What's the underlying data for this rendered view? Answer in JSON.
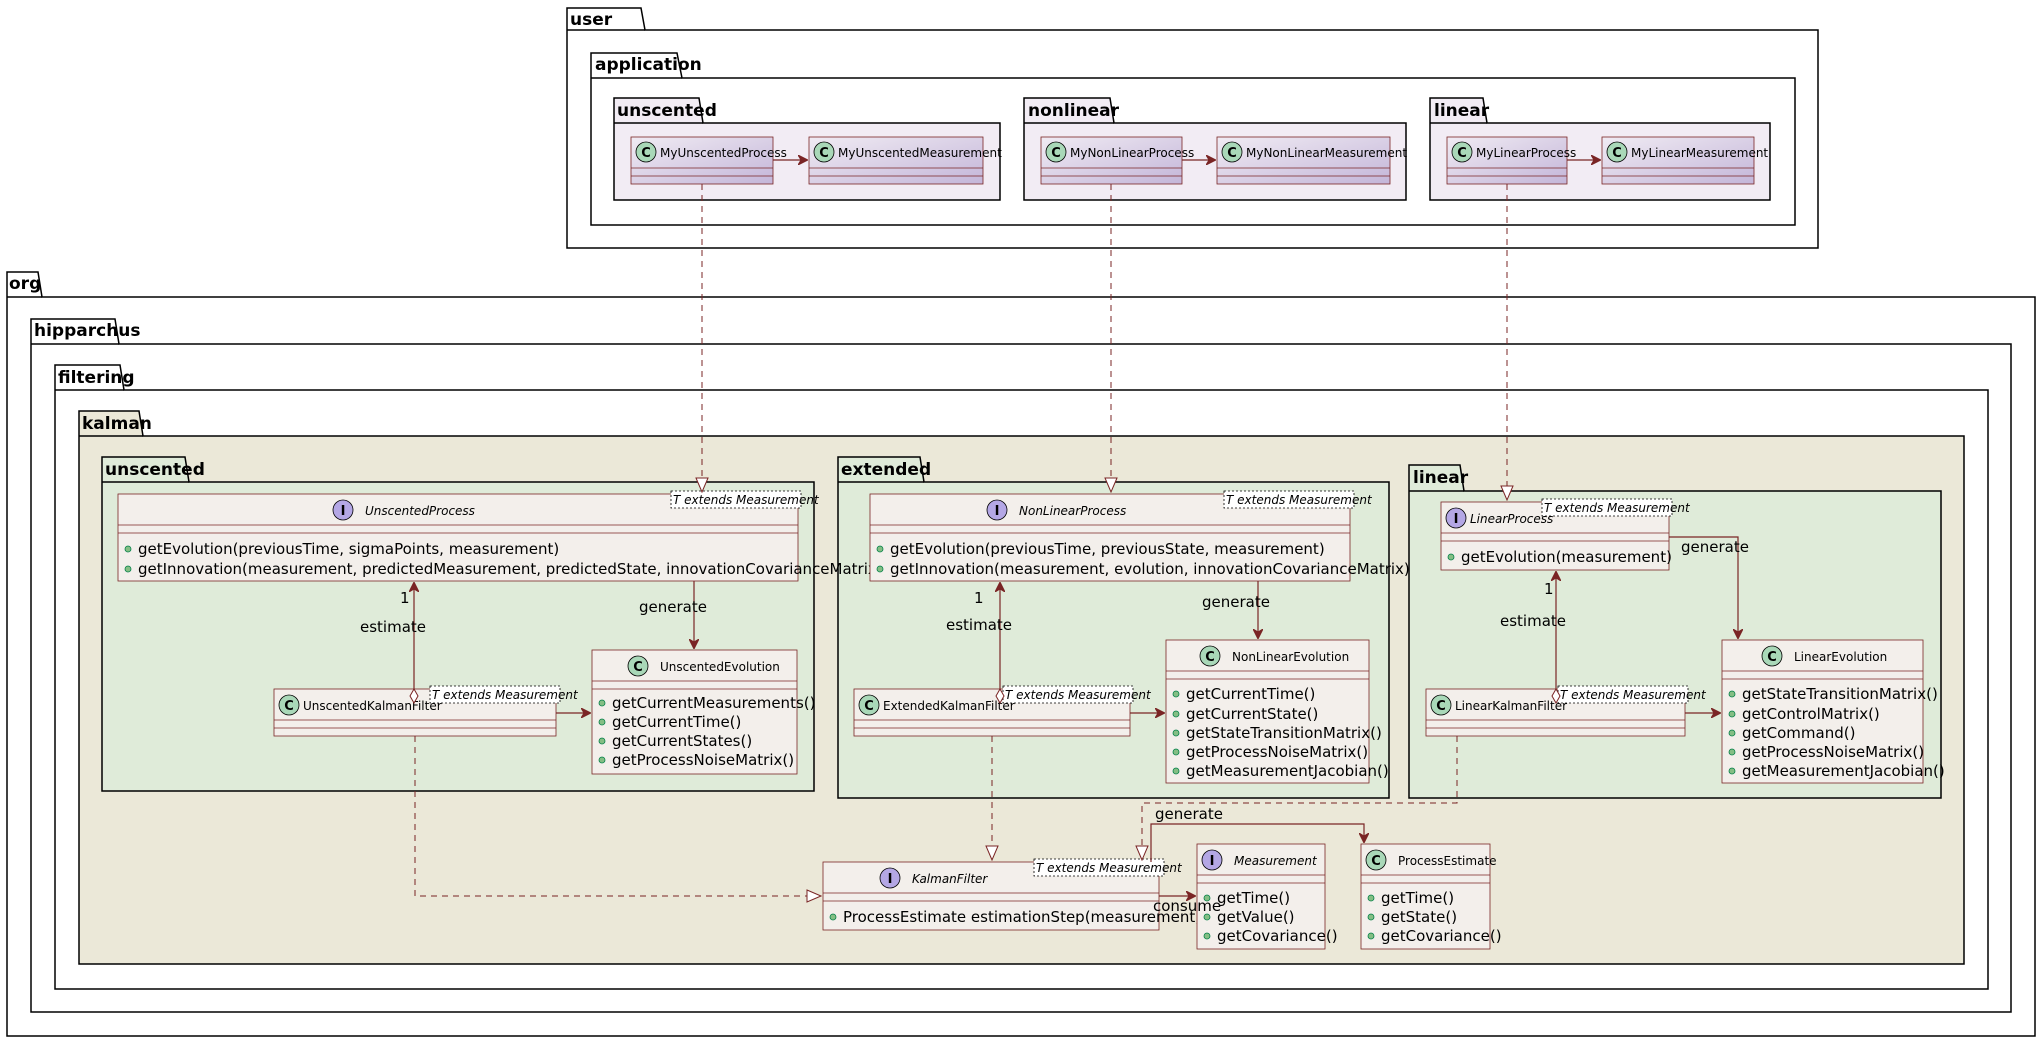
{
  "diagram": {
    "packages": {
      "user": "user",
      "application": "application",
      "app_unscented": "unscented",
      "app_nonlinear": "nonlinear",
      "app_linear": "linear",
      "org": "org",
      "hipparchus": "hipparchus",
      "filtering": "filtering",
      "kalman": "kalman",
      "k_unscented": "unscented",
      "k_extended": "extended",
      "k_linear": "linear"
    },
    "classes": {
      "my_unscented_process": {
        "name": "MyUnscentedProcess",
        "kind": "C"
      },
      "my_unscented_measurement": {
        "name": "MyUnscentedMeasurement",
        "kind": "C"
      },
      "my_nonlinear_process": {
        "name": "MyNonLinearProcess",
        "kind": "C"
      },
      "my_nonlinear_measurement": {
        "name": "MyNonLinearMeasurement",
        "kind": "C"
      },
      "my_linear_process": {
        "name": "MyLinearProcess",
        "kind": "C"
      },
      "my_linear_measurement": {
        "name": "MyLinearMeasurement",
        "kind": "C"
      },
      "unscented_process": {
        "name": "UnscentedProcess",
        "kind": "I",
        "tparam": "T extends Measurement",
        "members": [
          "getEvolution(previousTime, sigmaPoints, measurement)",
          "getInnovation(measurement, predictedMeasurement, predictedState, innovationCovarianceMatrix)"
        ]
      },
      "unscented_evolution": {
        "name": "UnscentedEvolution",
        "kind": "C",
        "members": [
          "getCurrentMeasurements()",
          "getCurrentTime()",
          "getCurrentStates()",
          "getProcessNoiseMatrix()"
        ]
      },
      "unscented_kalman_filter": {
        "name": "UnscentedKalmanFilter",
        "kind": "C",
        "tparam": "T extends Measurement"
      },
      "nonlinear_process": {
        "name": "NonLinearProcess",
        "kind": "I",
        "tparam": "T extends Measurement",
        "members": [
          "getEvolution(previousTime, previousState, measurement)",
          "getInnovation(measurement, evolution, innovationCovarianceMatrix)"
        ]
      },
      "nonlinear_evolution": {
        "name": "NonLinearEvolution",
        "kind": "C",
        "members": [
          "getCurrentTime()",
          "getCurrentState()",
          "getStateTransitionMatrix()",
          "getProcessNoiseMatrix()",
          "getMeasurementJacobian()"
        ]
      },
      "extended_kalman_filter": {
        "name": "ExtendedKalmanFilter",
        "kind": "C",
        "tparam": "T extends Measurement"
      },
      "linear_process": {
        "name": "LinearProcess",
        "kind": "I",
        "tparam": "T extends Measurement",
        "members": [
          "getEvolution(measurement)"
        ]
      },
      "linear_evolution": {
        "name": "LinearEvolution",
        "kind": "C",
        "members": [
          "getStateTransitionMatrix()",
          "getControlMatrix()",
          "getCommand()",
          "getProcessNoiseMatrix()",
          "getMeasurementJacobian()"
        ]
      },
      "linear_kalman_filter": {
        "name": "LinearKalmanFilter",
        "kind": "C",
        "tparam": "T extends Measurement"
      },
      "kalman_filter": {
        "name": "KalmanFilter",
        "kind": "I",
        "tparam": "T extends Measurement",
        "members": [
          "ProcessEstimate estimationStep(measurement)"
        ]
      },
      "measurement": {
        "name": "Measurement",
        "kind": "I",
        "members": [
          "getTime()",
          "getValue()",
          "getCovariance()"
        ]
      },
      "process_estimate": {
        "name": "ProcessEstimate",
        "kind": "C",
        "members": [
          "getTime()",
          "getState()",
          "getCovariance()"
        ]
      }
    },
    "edge_labels": {
      "generate": "generate",
      "estimate": "estimate",
      "one": "1",
      "consume": "consume"
    },
    "colors": {
      "edge": "#7a2525",
      "class_fill": "#f3efeb",
      "app_class_fill": "#cfc4e0",
      "app_class_fill_light": "#e8e0ee",
      "app_pkg_fill": "#f2ecf4",
      "kalman_fill": "#ebe8d8",
      "subpkg_fill": "#dfebd9",
      "circle_class": "#a9d8b8",
      "circle_interface": "#b4a7e5"
    }
  }
}
